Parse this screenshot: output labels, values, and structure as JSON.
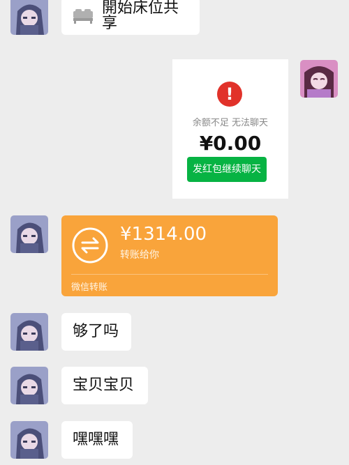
{
  "messages": {
    "bed_share": {
      "icon": "bed-icon",
      "text": "開始床位共享"
    },
    "balance_notice": {
      "icon": "exclamation-circle-icon",
      "message": "余额不足 无法聊天",
      "amount": "¥0.00",
      "button": "发红包继续聊天"
    },
    "transfer": {
      "icon": "transfer-arrows-icon",
      "amount": "¥1314.00",
      "description": "转账给你",
      "footer": "微信转账"
    },
    "text1": "够了吗",
    "text2": "宝贝宝贝",
    "text3": "嘿嘿嘿"
  },
  "colors": {
    "background": "#ededed",
    "bubble": "#ffffff",
    "transfer": "#f9a43b",
    "button": "#07b343",
    "warning": "#e1322a"
  }
}
